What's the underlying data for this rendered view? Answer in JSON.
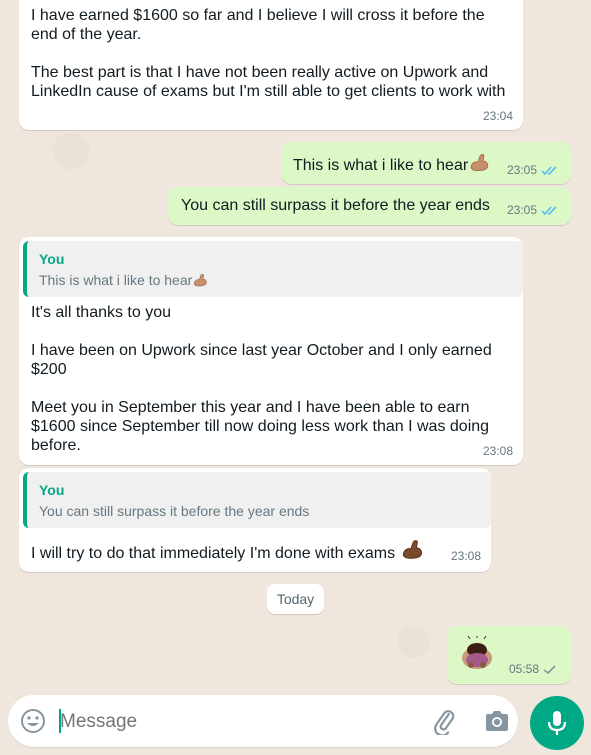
{
  "messages": [
    {
      "direction": "in",
      "text": "I have earned $1600 so far and I believe I will cross it before the end of the year.\n\nThe best part is that I have not been really active on Upwork and LinkedIn cause of exams but I'm still able to get clients to work with",
      "time": "23:04"
    },
    {
      "direction": "out",
      "text": "This is what i like to hear",
      "emoji": "flexed-biceps",
      "time": "23:05",
      "status": "read"
    },
    {
      "direction": "out",
      "text": "You can still surpass it before the year ends",
      "time": "23:05",
      "status": "read"
    },
    {
      "direction": "in",
      "quote": {
        "author": "You",
        "text": "This is what i like to hear",
        "emoji": "flexed-biceps"
      },
      "text": "It's all thanks to you\n\nI have been on Upwork since last year October and I only earned $200\n\nMeet you in September this year and I have been able to earn $1600 since September till now doing less work than I was doing before.",
      "time": "23:08"
    },
    {
      "direction": "in",
      "quote": {
        "author": "You",
        "text": "You can still surpass it before the year ends"
      },
      "text": "I will try to do that immediately I'm done with exams",
      "emoji": "flexed-biceps",
      "time": "23:08"
    },
    {
      "direction": "out",
      "emoji": "person-bowing",
      "time": "05:58",
      "status": "sent"
    }
  ],
  "date_divider": "Today",
  "composer": {
    "placeholder": "Message",
    "icons": [
      "emoji-icon",
      "attach-icon",
      "camera-icon",
      "mic-icon"
    ]
  },
  "colors": {
    "incoming": "#ffffff",
    "outgoing": "#dcf8c6",
    "accent": "#00a884",
    "read_ticks": "#53bdeb"
  }
}
